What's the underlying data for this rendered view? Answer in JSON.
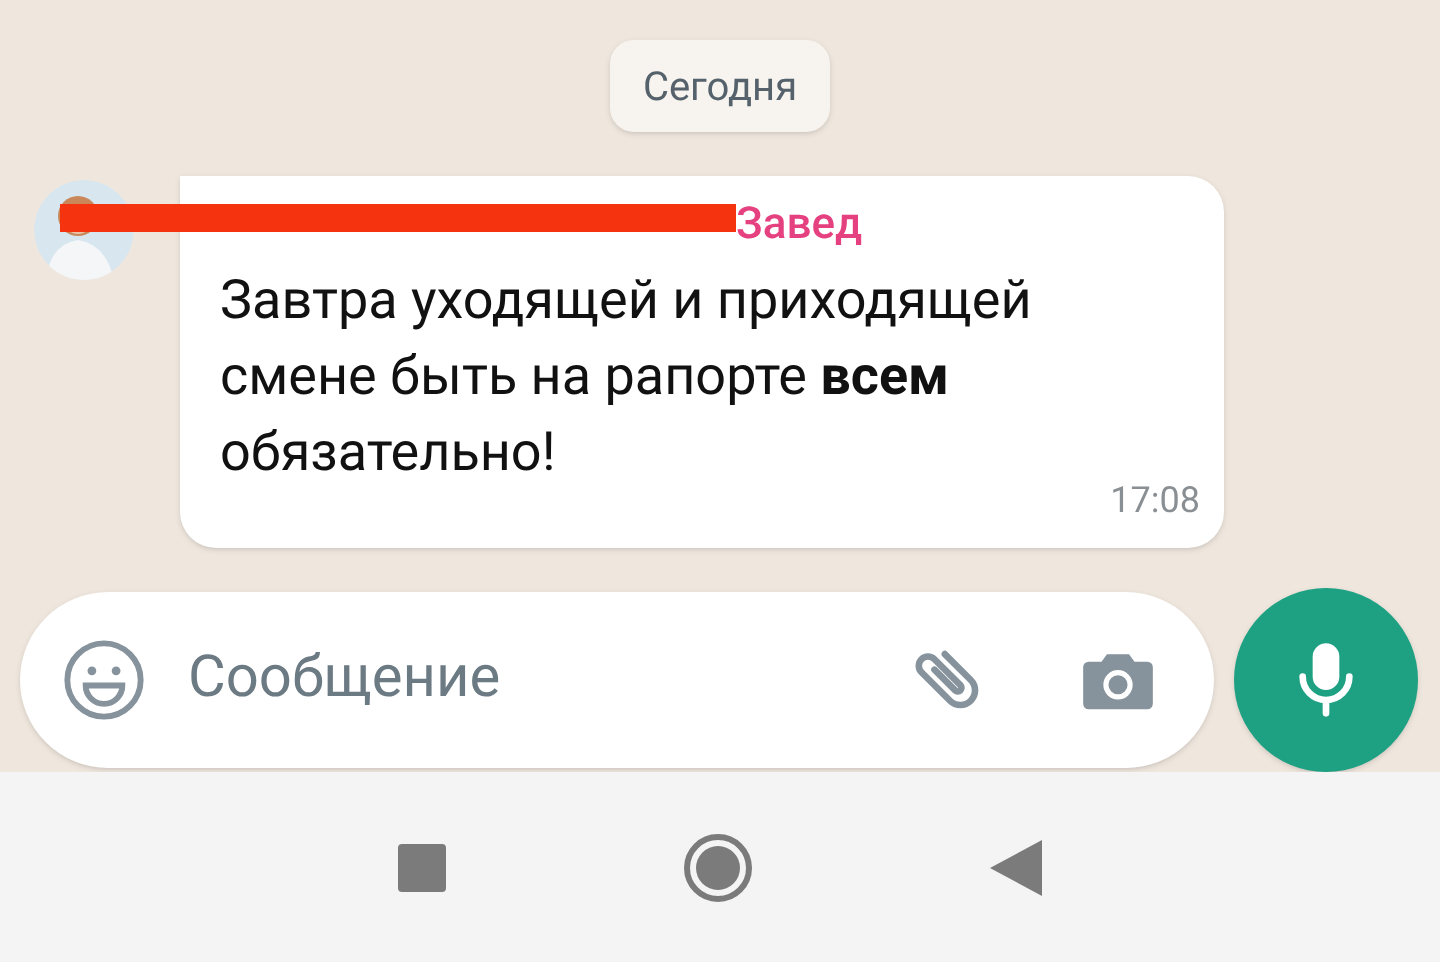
{
  "date_label": "Сегодня",
  "message": {
    "sender_redacted": true,
    "sender": "Завед",
    "color": "#e5407f",
    "text": "Завтра уходящей и приходящей смене быть на рапорте **всем** обязательно!",
    "time": "17:08"
  },
  "composer": {
    "placeholder": "Сообщение"
  }
}
